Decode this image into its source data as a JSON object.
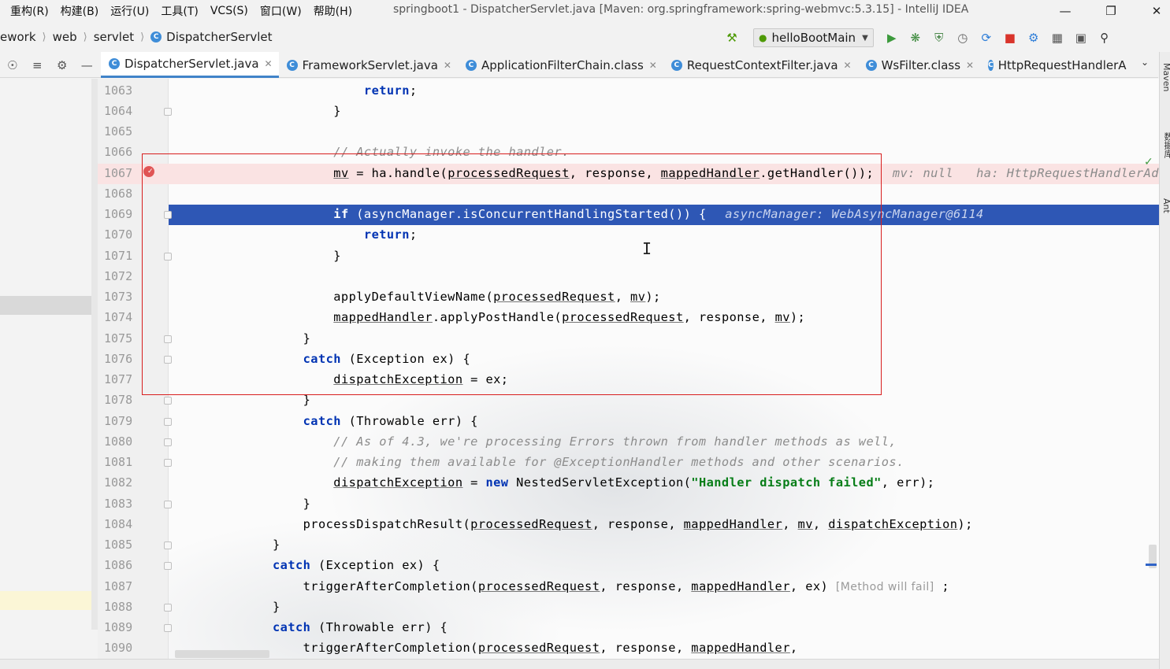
{
  "menu": [
    "重构(R)",
    "构建(B)",
    "运行(U)",
    "工具(T)",
    "VCS(S)",
    "窗口(W)",
    "帮助(H)"
  ],
  "window_title": "springboot1 - DispatcherServlet.java [Maven: org.springframework:spring-webmvc:5.3.15] - IntelliJ IDEA",
  "breadcrumb": {
    "part1": "ework",
    "part2": "web",
    "part3": "servlet",
    "part4": "DispatcherServlet"
  },
  "run_config": "helloBootMain",
  "tabs": [
    "DispatcherServlet.java",
    "FrameworkServlet.java",
    "ApplicationFilterChain.class",
    "RequestContextFilter.java",
    "WsFilter.class",
    "HttpRequestHandlerA"
  ],
  "right_tools": [
    "Maven",
    "数据库",
    "Ant"
  ],
  "code": {
    "l1063": "1063",
    "l1064": "1064",
    "l1065": "1065",
    "l1066": "1066",
    "l1067": "1067",
    "l1068": "1068",
    "l1069": "1069",
    "l1070": "1070",
    "l1071": "1071",
    "l1072": "1072",
    "l1073": "1073",
    "l1074": "1074",
    "l1075": "1075",
    "l1076": "1076",
    "l1077": "1077",
    "l1078": "1078",
    "l1079": "1079",
    "l1080": "1080",
    "l1081": "1081",
    "l1082": "1082",
    "l1083": "1083",
    "l1084": "1084",
    "l1085": "1085",
    "l1086": "1086",
    "l1087": "1087",
    "l1088": "1088",
    "l1089": "1089",
    "l1090": "1090",
    "hint_1067": "mv: null   ha: HttpRequestHandlerAdapter",
    "hint_1069": "asyncManager: WebAsyncManager@6114",
    "inlay_1087": "[Method will fail]",
    "string_1082": "\"Handler dispatch failed\"",
    "comment_1066": "// Actually invoke the handler.",
    "comment_1080": "// As of 4.3, we're processing Errors thrown from handler methods as well,",
    "comment_1081": "// making them available for @ExceptionHandler methods and other scenarios."
  },
  "colors": {
    "current_line": "#2e57b5",
    "breakpoint_line": "#fae3e3",
    "annotation_box": "#d81e1e",
    "keyword": "#0033b3",
    "string": "#067d17"
  }
}
